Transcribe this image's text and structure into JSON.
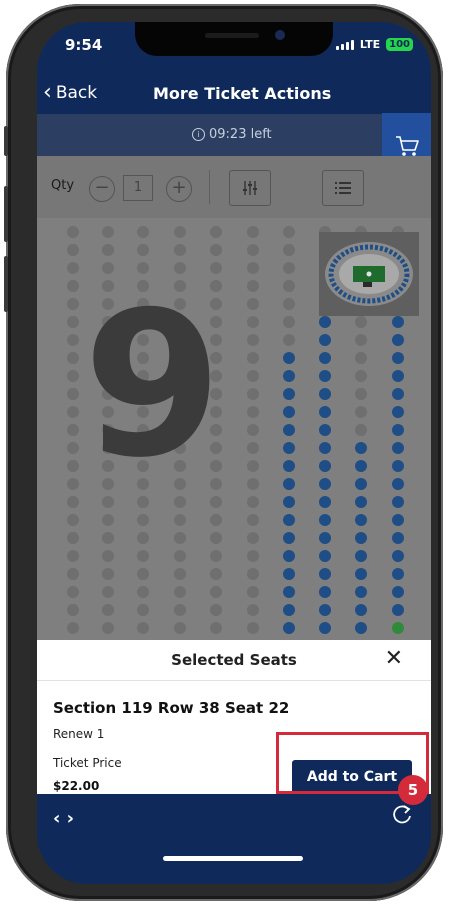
{
  "status_bar": {
    "time": "9:54",
    "network": "LTE",
    "battery": "100"
  },
  "nav": {
    "back_label": "Back",
    "title": "More Ticket Actions"
  },
  "timer": {
    "text": "09:23 left"
  },
  "toolbar": {
    "qty_label": "Qty",
    "qty_value": "1",
    "minus": "−",
    "plus": "+"
  },
  "map": {
    "section_label": "9"
  },
  "sheet": {
    "title": "Selected Seats",
    "close": "✕",
    "seat_line": "Section 119 Row 38 Seat 22",
    "renew": "Renew 1",
    "price_label": "Ticket Price",
    "price_value": "$22.00",
    "add_button": "Add to Cart"
  },
  "annotation": {
    "step_number": "5",
    "highlight_color": "#d42b3a"
  },
  "bottom_bar": {
    "left_icon": "‹ ›"
  },
  "colors": {
    "navy": "#0f2a5a",
    "accent_blue": "#22509f",
    "seat_available": "#1f4e86",
    "seat_unavailable": "#6f6f6f",
    "seat_selected": "#2f8a3b"
  },
  "icons": [
    "back-chevron-icon",
    "info-icon",
    "cart-icon",
    "filter-icon",
    "list-icon",
    "close-icon",
    "code-icon",
    "refresh-icon"
  ]
}
